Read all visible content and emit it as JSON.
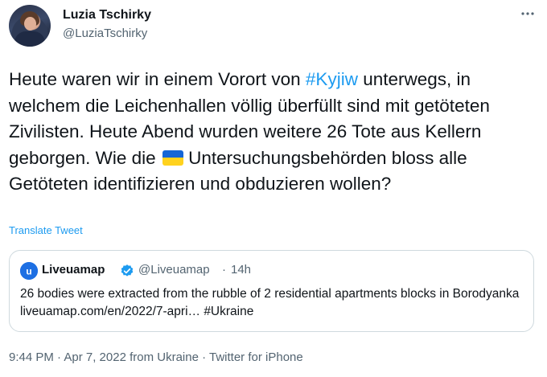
{
  "author": {
    "name": "Luzia Tschirky",
    "handle": "@LuziaTschirky"
  },
  "tweet": {
    "text_before_hashtag": "Heute waren wir in einem Vorort von ",
    "hashtag": "#Kyjiw",
    "text_after_hashtag": " unterwegs, in welchem die Leichenhallen völlig überfüllt sind mit getöteten Zivilisten. Heute Abend wurden weitere 26 Tote aus Kellern geborgen. Wie die ",
    "flag_icon": "ukraine-flag-emoji",
    "text_after_flag": " Untersuchungsbehörden bloss alle Getöteten identifizieren und obduzieren wollen?"
  },
  "translate_label": "Translate Tweet",
  "more_icon": "more-options-icon",
  "quote": {
    "name": "Liveuamap",
    "verified_icon": "verified-badge-icon",
    "handle": "@Liveuamap",
    "separator": "·",
    "time": "14h",
    "text": "26 bodies were extracted from the rubble of 2 residential apartments blocks in Borodyanka liveuamap.com/en/2022/7-apri…  #Ukraine"
  },
  "meta": {
    "timestamp": "9:44 PM · Apr 7, 2022 from Ukraine · Twitter for iPhone"
  },
  "colors": {
    "link": "#1d9bf0",
    "muted": "#536471",
    "text": "#0f1419",
    "border": "#cfd9de"
  }
}
